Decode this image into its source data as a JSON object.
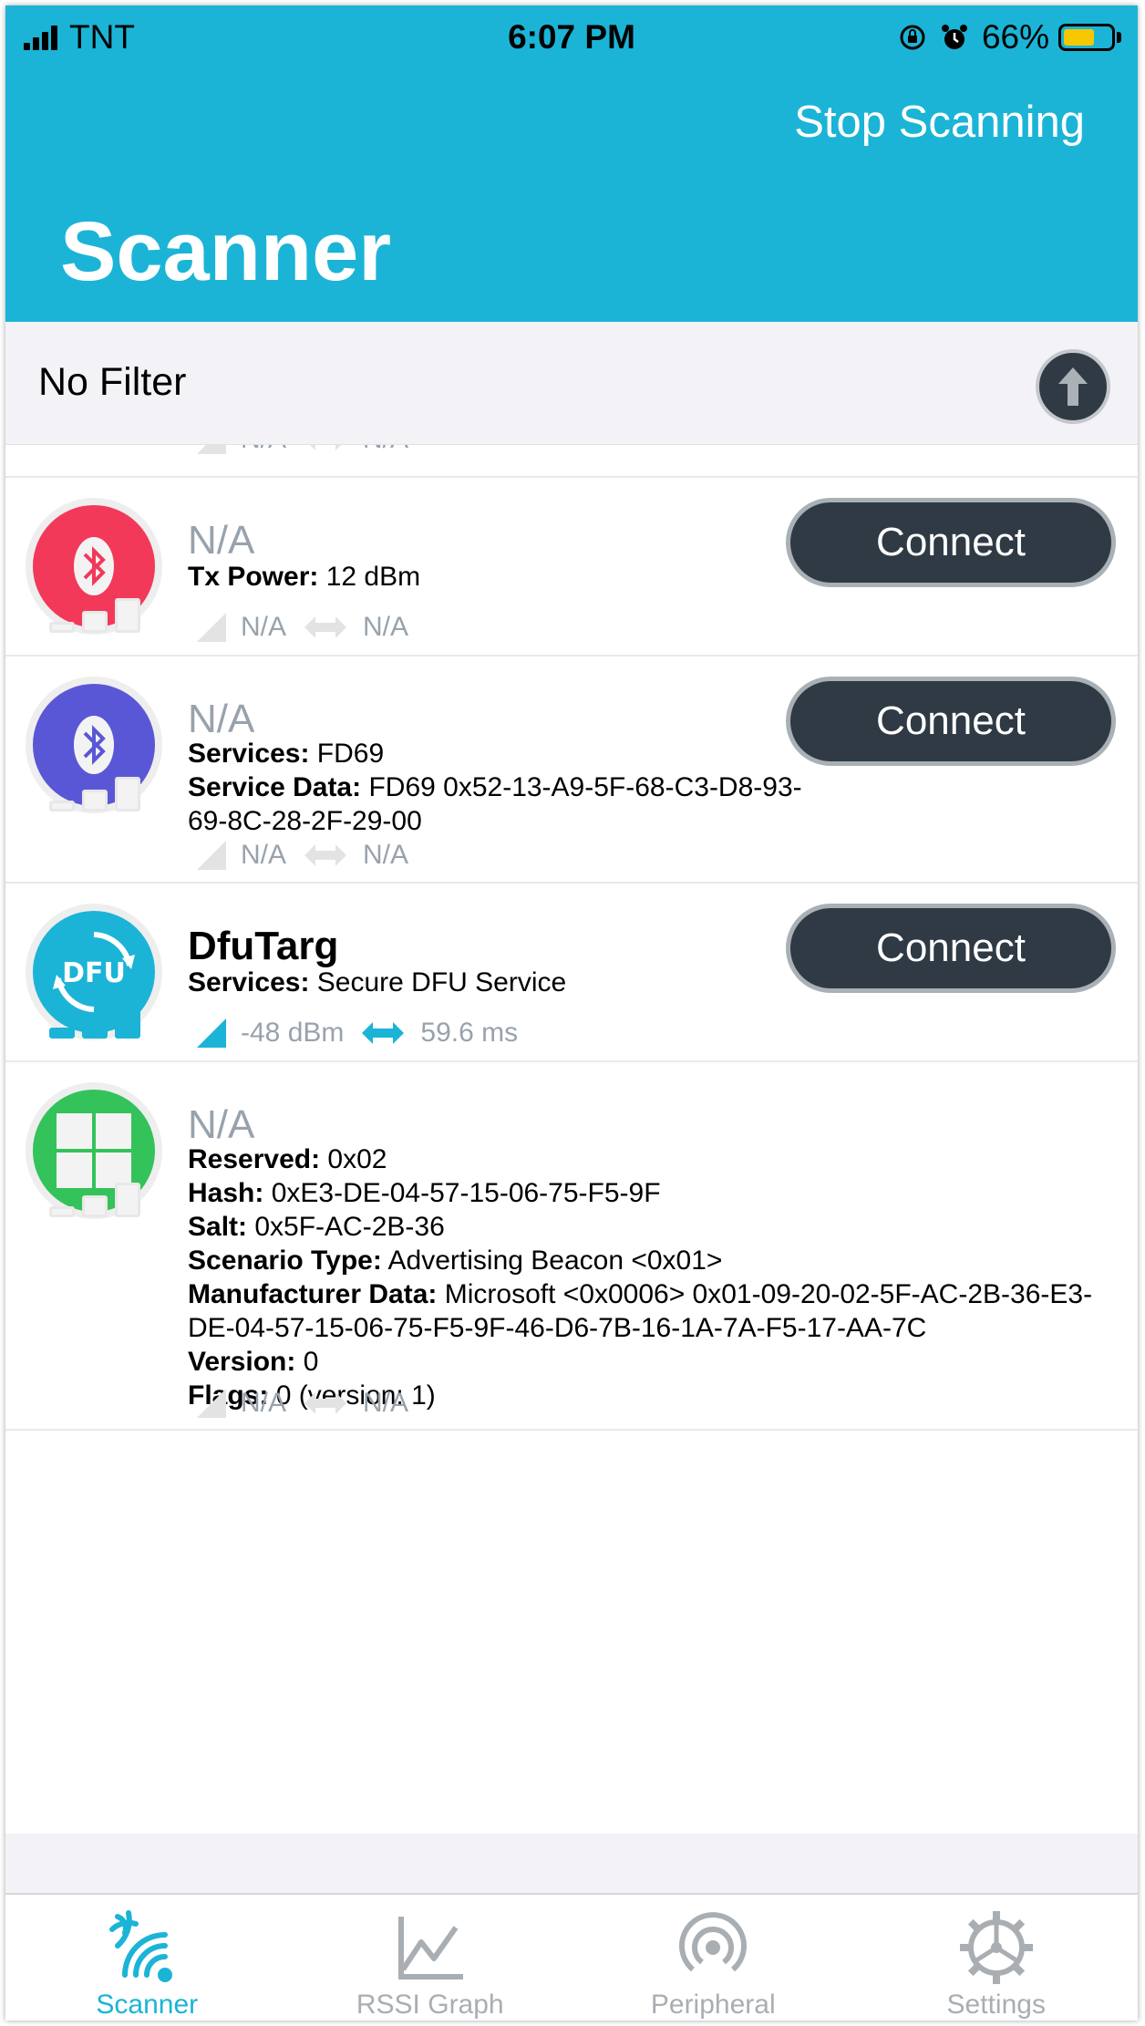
{
  "status_bar": {
    "carrier": "TNT",
    "time": "6:07 PM",
    "battery": "66%"
  },
  "header": {
    "action": "Stop Scanning",
    "title": "Scanner"
  },
  "filter": {
    "label": "No Filter"
  },
  "list": {
    "partial": {
      "rssi": "N/A",
      "interval": "N/A"
    },
    "devices": [
      {
        "name": "N/A",
        "icon": "bluetooth-icon",
        "icon_color": "#f2395a",
        "connect": "Connect",
        "details": [
          {
            "key": "Tx Power:",
            "value": "12 dBm"
          }
        ],
        "rssi": "N/A",
        "interval": "N/A"
      },
      {
        "name": "N/A",
        "icon": "bluetooth-icon",
        "icon_color": "#5a57d6",
        "connect": "Connect",
        "details": [
          {
            "key": "Services:",
            "value": "FD69"
          },
          {
            "key": "Service Data:",
            "value": "FD69 0x52-13-A9-5F-68-C3-D8-93-69-8C-28-2F-29-00"
          }
        ],
        "rssi": "N/A",
        "interval": "N/A"
      },
      {
        "name": "DfuTarg",
        "icon": "dfu-icon",
        "icon_color": "#1bb4d6",
        "connect": "Connect",
        "details": [
          {
            "key": "Services:",
            "value": "Secure DFU Service"
          }
        ],
        "rssi": "-48 dBm",
        "interval": "59.6 ms"
      },
      {
        "name": "N/A",
        "icon": "windows-icon",
        "icon_color": "#34c25a",
        "details": [
          {
            "key": "Reserved:",
            "value": "0x02"
          },
          {
            "key": "Hash:",
            "value": "0xE3-DE-04-57-15-06-75-F5-9F"
          },
          {
            "key": "Salt:",
            "value": "0x5F-AC-2B-36"
          },
          {
            "key": "Scenario Type:",
            "value": "Advertising Beacon <0x01>"
          },
          {
            "key": "Manufacturer Data:",
            "value": "Microsoft <0x0006> 0x01-09-20-02-5F-AC-2B-36-E3-DE-04-57-15-06-75-F5-9F-46-D6-7B-16-1A-7A-F5-17-AA-7C"
          },
          {
            "key": "Version:",
            "value": "0"
          },
          {
            "key": "Flags:",
            "value": "0 (version: 1)"
          }
        ],
        "rssi": "N/A",
        "interval": "N/A"
      }
    ]
  },
  "tabs": [
    {
      "label": "Scanner",
      "icon": "scanner-icon",
      "active": true
    },
    {
      "label": "RSSI Graph",
      "icon": "graph-icon",
      "active": false
    },
    {
      "label": "Peripheral",
      "icon": "peripheral-icon",
      "active": false
    },
    {
      "label": "Settings",
      "icon": "gear-icon",
      "active": false
    }
  ],
  "colors": {
    "accent": "#1bb4d6",
    "button_dark": "#2f3a44",
    "muted": "#98a2ac"
  }
}
